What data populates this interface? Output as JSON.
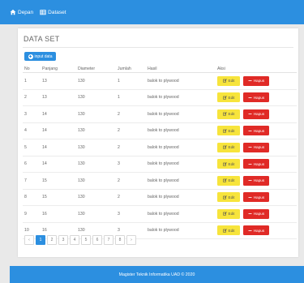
{
  "nav": {
    "home_label": "Depan",
    "dataset_label": "Dataset"
  },
  "panel": {
    "title": "DATA SET",
    "input_button_label": "input data"
  },
  "table": {
    "headers": [
      "No",
      "Panjang",
      "Diameter",
      "Jumlah",
      "Hasil",
      "Aksi"
    ],
    "rows": [
      {
        "no": "1",
        "panjang": "13",
        "diameter": "130",
        "jumlah": "1",
        "hasil": "balok to plywood"
      },
      {
        "no": "2",
        "panjang": "13",
        "diameter": "130",
        "jumlah": "1",
        "hasil": "balok to plywood"
      },
      {
        "no": "3",
        "panjang": "14",
        "diameter": "130",
        "jumlah": "2",
        "hasil": "balok to plywood"
      },
      {
        "no": "4",
        "panjang": "14",
        "diameter": "130",
        "jumlah": "2",
        "hasil": "balok to plywood"
      },
      {
        "no": "5",
        "panjang": "14",
        "diameter": "130",
        "jumlah": "2",
        "hasil": "balok to plywood"
      },
      {
        "no": "6",
        "panjang": "14",
        "diameter": "130",
        "jumlah": "3",
        "hasil": "balok to plywood"
      },
      {
        "no": "7",
        "panjang": "15",
        "diameter": "130",
        "jumlah": "2",
        "hasil": "balok to plywood"
      },
      {
        "no": "8",
        "panjang": "15",
        "diameter": "130",
        "jumlah": "2",
        "hasil": "balok to plywood"
      },
      {
        "no": "9",
        "panjang": "16",
        "diameter": "130",
        "jumlah": "3",
        "hasil": "balok to plywood"
      },
      {
        "no": "10",
        "panjang": "16",
        "diameter": "130",
        "jumlah": "3",
        "hasil": "balok to plywood"
      }
    ],
    "edit_label": "Edit",
    "delete_label": "Hapus"
  },
  "pagination": {
    "prev": "‹",
    "pages": [
      "1",
      "2",
      "3",
      "4",
      "5",
      "6",
      "7",
      "8"
    ],
    "active": "1",
    "next": "›"
  },
  "footer": {
    "text": "Magister Teknik Informatika UAD © 2020"
  },
  "icons": {
    "home": "home-icon",
    "dataset": "table-icon",
    "add": "plus-circle-icon",
    "edit": "edit-icon",
    "delete": "minus-icon"
  },
  "colors": {
    "primary": "#2c8fe0",
    "edit": "#f7e43b",
    "delete": "#e02a26"
  }
}
